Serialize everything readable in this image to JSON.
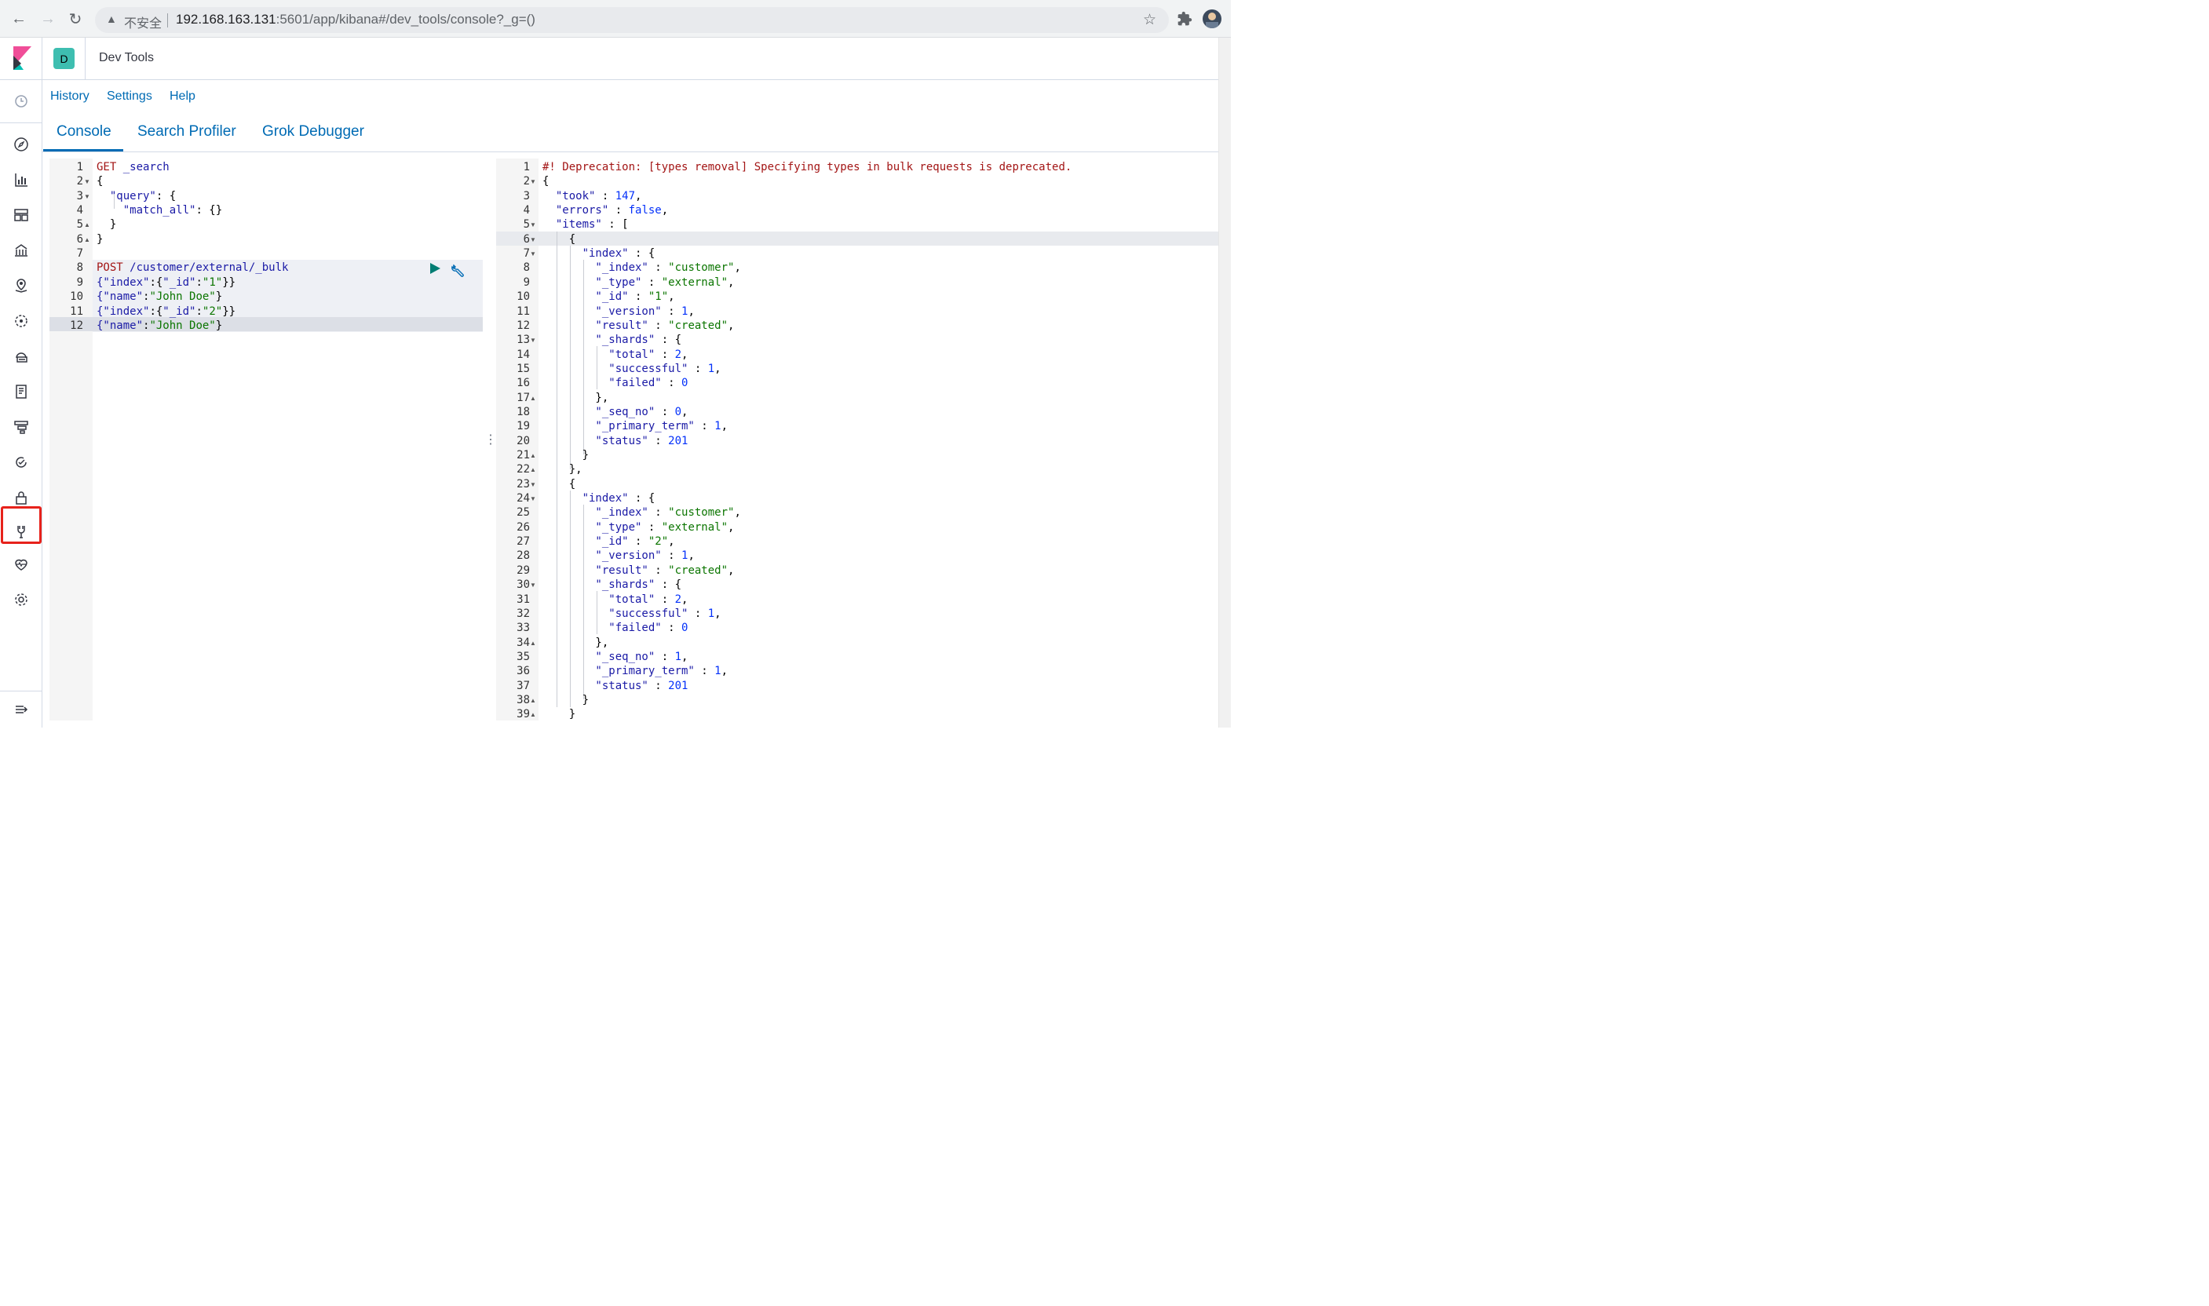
{
  "browser": {
    "insecure_label": "不安全",
    "url_host": "192.168.163.131",
    "url_rest": ":5601/app/kibana#/dev_tools/console?_g=()"
  },
  "header": {
    "space_initial": "D",
    "breadcrumb": "Dev Tools"
  },
  "top_menu": [
    "History",
    "Settings",
    "Help"
  ],
  "tabs": [
    "Console",
    "Search Profiler",
    "Grok Debugger"
  ],
  "request_editor": {
    "lines": [
      [
        {
          "t": "GET",
          "c": "k"
        },
        {
          "t": " _search",
          "c": "s"
        }
      ],
      [
        {
          "t": "{",
          "c": "plain"
        }
      ],
      [
        {
          "t": "  \"query\"",
          "c": "key"
        },
        {
          "t": ": {",
          "c": "plain"
        }
      ],
      [
        {
          "t": "    \"match_all\"",
          "c": "key"
        },
        {
          "t": ": {}",
          "c": "plain"
        }
      ],
      [
        {
          "t": "  }",
          "c": "plain"
        }
      ],
      [
        {
          "t": "}",
          "c": "plain"
        }
      ],
      [],
      [
        {
          "t": "POST",
          "c": "k"
        },
        {
          "t": " /customer/external/_bulk",
          "c": "s"
        }
      ],
      [
        {
          "t": "{\"index\"",
          "c": "key"
        },
        {
          "t": ":{",
          "c": "plain"
        },
        {
          "t": "\"_id\"",
          "c": "key"
        },
        {
          "t": ":",
          "c": "plain"
        },
        {
          "t": "\"1\"",
          "c": "str"
        },
        {
          "t": "}}",
          "c": "plain"
        }
      ],
      [
        {
          "t": "{\"name\"",
          "c": "key"
        },
        {
          "t": ":",
          "c": "plain"
        },
        {
          "t": "\"John Doe\"",
          "c": "str"
        },
        {
          "t": "}",
          "c": "plain"
        }
      ],
      [
        {
          "t": "{\"index\"",
          "c": "key"
        },
        {
          "t": ":{",
          "c": "plain"
        },
        {
          "t": "\"_id\"",
          "c": "key"
        },
        {
          "t": ":",
          "c": "plain"
        },
        {
          "t": "\"2\"",
          "c": "str"
        },
        {
          "t": "}}",
          "c": "plain"
        }
      ],
      [
        {
          "t": "{\"name\"",
          "c": "key"
        },
        {
          "t": ":",
          "c": "plain"
        },
        {
          "t": "\"John Doe\"",
          "c": "str"
        },
        {
          "t": "}",
          "c": "plain"
        }
      ]
    ],
    "folds": {
      "2": "open",
      "3": "open",
      "5": "close",
      "6": "close"
    }
  },
  "response_editor": {
    "lines": [
      [
        {
          "t": "#! Deprecation: [types removal] Specifying types in bulk requests is deprecated.",
          "c": "k"
        }
      ],
      [
        {
          "t": "{",
          "c": "plain"
        }
      ],
      [
        {
          "t": "  \"took\"",
          "c": "key"
        },
        {
          "t": " : ",
          "c": "plain"
        },
        {
          "t": "147",
          "c": "num"
        },
        {
          "t": ",",
          "c": "plain"
        }
      ],
      [
        {
          "t": "  \"errors\"",
          "c": "key"
        },
        {
          "t": " : ",
          "c": "plain"
        },
        {
          "t": "false",
          "c": "bool"
        },
        {
          "t": ",",
          "c": "plain"
        }
      ],
      [
        {
          "t": "  \"items\"",
          "c": "key"
        },
        {
          "t": " : [",
          "c": "plain"
        }
      ],
      [
        {
          "t": "    {",
          "c": "plain"
        }
      ],
      [
        {
          "t": "      \"index\"",
          "c": "key"
        },
        {
          "t": " : {",
          "c": "plain"
        }
      ],
      [
        {
          "t": "        \"_index\"",
          "c": "key"
        },
        {
          "t": " : ",
          "c": "plain"
        },
        {
          "t": "\"customer\"",
          "c": "str"
        },
        {
          "t": ",",
          "c": "plain"
        }
      ],
      [
        {
          "t": "        \"_type\"",
          "c": "key"
        },
        {
          "t": " : ",
          "c": "plain"
        },
        {
          "t": "\"external\"",
          "c": "str"
        },
        {
          "t": ",",
          "c": "plain"
        }
      ],
      [
        {
          "t": "        \"_id\"",
          "c": "key"
        },
        {
          "t": " : ",
          "c": "plain"
        },
        {
          "t": "\"1\"",
          "c": "str"
        },
        {
          "t": ",",
          "c": "plain"
        }
      ],
      [
        {
          "t": "        \"_version\"",
          "c": "key"
        },
        {
          "t": " : ",
          "c": "plain"
        },
        {
          "t": "1",
          "c": "num"
        },
        {
          "t": ",",
          "c": "plain"
        }
      ],
      [
        {
          "t": "        \"result\"",
          "c": "key"
        },
        {
          "t": " : ",
          "c": "plain"
        },
        {
          "t": "\"created\"",
          "c": "str"
        },
        {
          "t": ",",
          "c": "plain"
        }
      ],
      [
        {
          "t": "        \"_shards\"",
          "c": "key"
        },
        {
          "t": " : {",
          "c": "plain"
        }
      ],
      [
        {
          "t": "          \"total\"",
          "c": "key"
        },
        {
          "t": " : ",
          "c": "plain"
        },
        {
          "t": "2",
          "c": "num"
        },
        {
          "t": ",",
          "c": "plain"
        }
      ],
      [
        {
          "t": "          \"successful\"",
          "c": "key"
        },
        {
          "t": " : ",
          "c": "plain"
        },
        {
          "t": "1",
          "c": "num"
        },
        {
          "t": ",",
          "c": "plain"
        }
      ],
      [
        {
          "t": "          \"failed\"",
          "c": "key"
        },
        {
          "t": " : ",
          "c": "plain"
        },
        {
          "t": "0",
          "c": "num"
        }
      ],
      [
        {
          "t": "        },",
          "c": "plain"
        }
      ],
      [
        {
          "t": "        \"_seq_no\"",
          "c": "key"
        },
        {
          "t": " : ",
          "c": "plain"
        },
        {
          "t": "0",
          "c": "num"
        },
        {
          "t": ",",
          "c": "plain"
        }
      ],
      [
        {
          "t": "        \"_primary_term\"",
          "c": "key"
        },
        {
          "t": " : ",
          "c": "plain"
        },
        {
          "t": "1",
          "c": "num"
        },
        {
          "t": ",",
          "c": "plain"
        }
      ],
      [
        {
          "t": "        \"status\"",
          "c": "key"
        },
        {
          "t": " : ",
          "c": "plain"
        },
        {
          "t": "201",
          "c": "num"
        }
      ],
      [
        {
          "t": "      }",
          "c": "plain"
        }
      ],
      [
        {
          "t": "    },",
          "c": "plain"
        }
      ],
      [
        {
          "t": "    {",
          "c": "plain"
        }
      ],
      [
        {
          "t": "      \"index\"",
          "c": "key"
        },
        {
          "t": " : {",
          "c": "plain"
        }
      ],
      [
        {
          "t": "        \"_index\"",
          "c": "key"
        },
        {
          "t": " : ",
          "c": "plain"
        },
        {
          "t": "\"customer\"",
          "c": "str"
        },
        {
          "t": ",",
          "c": "plain"
        }
      ],
      [
        {
          "t": "        \"_type\"",
          "c": "key"
        },
        {
          "t": " : ",
          "c": "plain"
        },
        {
          "t": "\"external\"",
          "c": "str"
        },
        {
          "t": ",",
          "c": "plain"
        }
      ],
      [
        {
          "t": "        \"_id\"",
          "c": "key"
        },
        {
          "t": " : ",
          "c": "plain"
        },
        {
          "t": "\"2\"",
          "c": "str"
        },
        {
          "t": ",",
          "c": "plain"
        }
      ],
      [
        {
          "t": "        \"_version\"",
          "c": "key"
        },
        {
          "t": " : ",
          "c": "plain"
        },
        {
          "t": "1",
          "c": "num"
        },
        {
          "t": ",",
          "c": "plain"
        }
      ],
      [
        {
          "t": "        \"result\"",
          "c": "key"
        },
        {
          "t": " : ",
          "c": "plain"
        },
        {
          "t": "\"created\"",
          "c": "str"
        },
        {
          "t": ",",
          "c": "plain"
        }
      ],
      [
        {
          "t": "        \"_shards\"",
          "c": "key"
        },
        {
          "t": " : {",
          "c": "plain"
        }
      ],
      [
        {
          "t": "          \"total\"",
          "c": "key"
        },
        {
          "t": " : ",
          "c": "plain"
        },
        {
          "t": "2",
          "c": "num"
        },
        {
          "t": ",",
          "c": "plain"
        }
      ],
      [
        {
          "t": "          \"successful\"",
          "c": "key"
        },
        {
          "t": " : ",
          "c": "plain"
        },
        {
          "t": "1",
          "c": "num"
        },
        {
          "t": ",",
          "c": "plain"
        }
      ],
      [
        {
          "t": "          \"failed\"",
          "c": "key"
        },
        {
          "t": " : ",
          "c": "plain"
        },
        {
          "t": "0",
          "c": "num"
        }
      ],
      [
        {
          "t": "        },",
          "c": "plain"
        }
      ],
      [
        {
          "t": "        \"_seq_no\"",
          "c": "key"
        },
        {
          "t": " : ",
          "c": "plain"
        },
        {
          "t": "1",
          "c": "num"
        },
        {
          "t": ",",
          "c": "plain"
        }
      ],
      [
        {
          "t": "        \"_primary_term\"",
          "c": "key"
        },
        {
          "t": " : ",
          "c": "plain"
        },
        {
          "t": "1",
          "c": "num"
        },
        {
          "t": ",",
          "c": "plain"
        }
      ],
      [
        {
          "t": "        \"status\"",
          "c": "key"
        },
        {
          "t": " : ",
          "c": "plain"
        },
        {
          "t": "201",
          "c": "num"
        }
      ],
      [
        {
          "t": "      }",
          "c": "plain"
        }
      ],
      [
        {
          "t": "    }",
          "c": "plain"
        }
      ]
    ],
    "folds": {
      "2": "open",
      "5": "open",
      "6": "open",
      "7": "open",
      "13": "open",
      "17": "close",
      "21": "close",
      "22": "close",
      "23": "open",
      "24": "open",
      "30": "open",
      "34": "close",
      "38": "close",
      "39": "close"
    }
  },
  "sidenav_icons": [
    "recently-viewed-icon",
    "discover-icon",
    "visualize-icon",
    "dashboard-icon",
    "canvas-icon",
    "maps-icon",
    "ml-icon",
    "infrastructure-icon",
    "logs-icon",
    "apm-icon",
    "uptime-icon",
    "security-icon",
    "dev-tools-icon",
    "monitoring-icon",
    "management-icon",
    "collapse-icon"
  ],
  "colors": {
    "accent": "#006bb4",
    "highlight": "#e7221b",
    "space_badge": "#3ebeb0"
  }
}
